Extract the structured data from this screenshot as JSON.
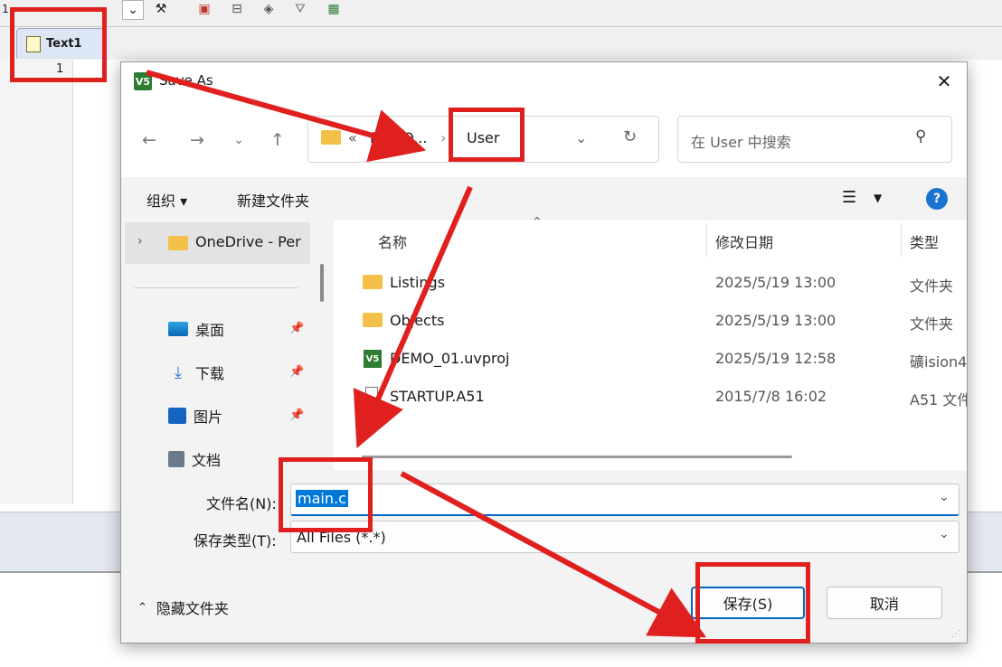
{
  "ide": {
    "toolbar_left_glyph": "1",
    "toolbar_icons": [
      "dropdown-icon",
      "wand-icon",
      "target-icon",
      "layout-icon",
      "diamond-icon",
      "filter-icon",
      "map-icon"
    ],
    "editor_tab": "Text1",
    "line_number": "1"
  },
  "dialog": {
    "title": "Save As",
    "app_icon_text": "V5",
    "close": "✕",
    "address": {
      "parent": "DEMO...",
      "separator": "›",
      "current": "User"
    },
    "search_placeholder": "在 User 中搜索",
    "commands": {
      "organize": "组织 ▾",
      "new_folder": "新建文件夹"
    },
    "help": "?",
    "nav": {
      "onedrive": "OneDrive - Per",
      "items": [
        "桌面",
        "下载",
        "图片",
        "文档"
      ]
    },
    "columns": [
      "名称",
      "修改日期",
      "类型"
    ],
    "files": [
      {
        "name": "Listings",
        "modified": "2025/5/19 13:00",
        "type": "文件夹",
        "icon": "folder-icon"
      },
      {
        "name": "Objects",
        "modified": "2025/5/19 13:00",
        "type": "文件夹",
        "icon": "folder-icon"
      },
      {
        "name": "DEMO_01.uvproj",
        "modified": "2025/5/19 12:58",
        "type": "礦ision4",
        "icon": "uvision-icon"
      },
      {
        "name": "STARTUP.A51",
        "modified": "2015/7/8 16:02",
        "type": "A51 文件",
        "icon": "file-icon"
      }
    ],
    "filename_label": "文件名(N):",
    "filename_value": "main.c",
    "filetype_label": "保存类型(T):",
    "filetype_value": "All Files (*.*)",
    "hide_folders": "隐藏文件夹",
    "save_button": "保存(S)",
    "cancel_button": "取消"
  },
  "colors": {
    "annotation_red": "#e0201f",
    "accent_blue": "#0067c0",
    "selection_blue": "#0078d7"
  }
}
